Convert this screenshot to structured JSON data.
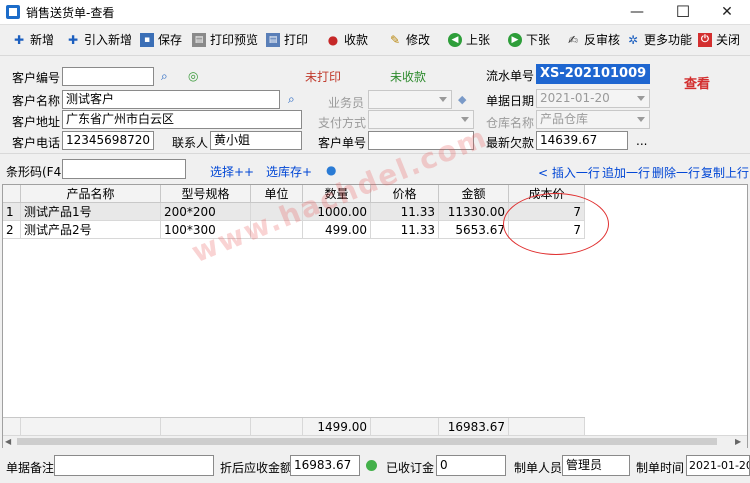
{
  "window": {
    "title": "销售送货单-查看",
    "min": "—",
    "max": "☐",
    "close": "✕"
  },
  "toolbar": [
    {
      "label": "新增",
      "icon": "plus-icon"
    },
    {
      "label": "引入新增",
      "icon": "plus-icon"
    },
    {
      "label": "保存",
      "icon": "save-icon"
    },
    {
      "label": "打印预览",
      "icon": "print-preview-icon"
    },
    {
      "label": "打印",
      "icon": "print-icon"
    },
    {
      "label": "收款",
      "icon": "collect-icon"
    },
    {
      "label": "修改",
      "icon": "edit-icon"
    },
    {
      "label": "上张",
      "icon": "prev-icon"
    },
    {
      "label": "下张",
      "icon": "next-icon"
    },
    {
      "label": "反审核",
      "icon": "unaudit-icon"
    },
    {
      "label": "更多功能",
      "icon": "gear-icon"
    },
    {
      "label": "关闭",
      "icon": "close-icon"
    }
  ],
  "form": {
    "customer_no_label": "客户编号",
    "customer_no": "",
    "status_print": "未打印",
    "status_payment": "未收款",
    "serial_label": "流水单号",
    "serial_no": "XS-202101009",
    "view_mode": "查看",
    "customer_name_label": "客户名称",
    "customer_name": "测试客户",
    "salesman_label": "业务员",
    "salesman": "",
    "doc_date_label": "单据日期",
    "doc_date": "2021-01-20",
    "address_label": "客户地址",
    "address": "广东省广州市白云区",
    "pay_method_label": "支付方式",
    "pay_method": "",
    "warehouse_label": "仓库名称",
    "warehouse": "产品仓库",
    "phone_label": "客户电话",
    "phone": "12345698720",
    "contact_label": "联系人",
    "contact": "黄小姐",
    "cust_order_label": "客户单号",
    "cust_order": "",
    "latest_debt_label": "最新欠款",
    "latest_debt": "14639.67",
    "more": "..."
  },
  "barcode": {
    "label": "条形码(F4)",
    "value": "",
    "select_more": "选择++",
    "select_stock": "选库存+",
    "insert_row": "< 插入一行",
    "append_row": "追加一行",
    "delete_row": "删除一行",
    "copy_prev": "复制上行"
  },
  "grid": {
    "headers": [
      "",
      "产品名称",
      "型号规格",
      "单位",
      "数量",
      "价格",
      "金额",
      "成本价"
    ],
    "rows": [
      {
        "idx": "1",
        "name": "测试产品1号",
        "spec": "200*200",
        "unit": "",
        "qty": "1000.00",
        "price": "11.33",
        "amount": "11330.00",
        "cost": "7"
      },
      {
        "idx": "2",
        "name": "测试产品2号",
        "spec": "100*300",
        "unit": "",
        "qty": "499.00",
        "price": "11.33",
        "amount": "5653.67",
        "cost": "7"
      }
    ],
    "total_qty": "1499.00",
    "total_amount": "16983.67"
  },
  "footer": {
    "remark_label": "单据备注",
    "remark": "",
    "net_receivable_label": "折后应收金额",
    "net_receivable": "16983.67",
    "received_deposit_label": "已收订金",
    "received_deposit": "0",
    "creator_label": "制单人员",
    "creator": "管理员",
    "create_time_label": "制单时间",
    "create_time": "2021-01-20"
  },
  "watermark": "www.hachdel.com"
}
